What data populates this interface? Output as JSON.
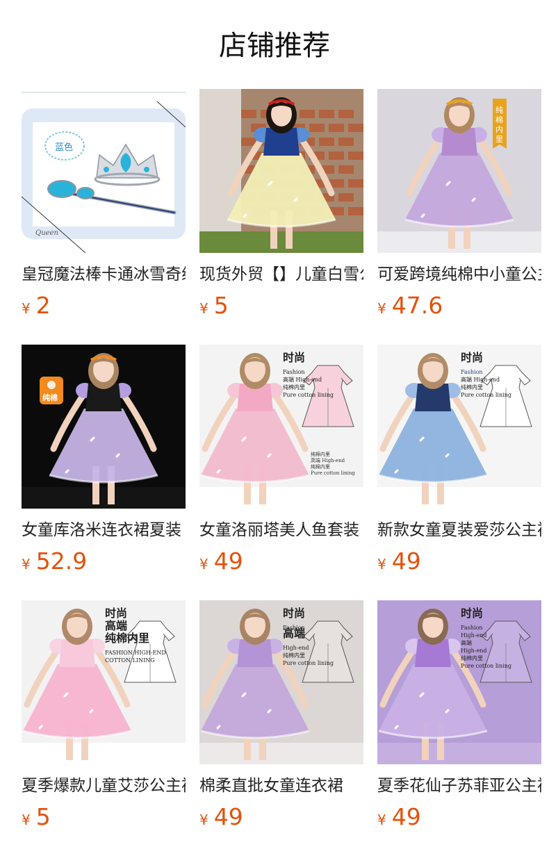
{
  "section": {
    "title": "店铺推荐"
  },
  "currency_symbol": "¥",
  "products": [
    {
      "title": "皇冠魔法棒卡通冰雪奇缘",
      "price": "2",
      "image": {
        "kind": "crown-wand",
        "bg": "#ffffff",
        "panel": "#dfe9f6",
        "badge_text": "蓝色",
        "signature": "Queen"
      }
    },
    {
      "title": "现货外贸【】儿童白雪公主",
      "price": "5",
      "image": {
        "kind": "dress",
        "bg": "#a7866e",
        "floor": "#6a8a3c",
        "skirt": "#f2efb6",
        "bodice": "#1f3f8f",
        "sleeve": "#5a8ed6",
        "hair": "#1d1510",
        "accent": "#cc1f1f"
      }
    },
    {
      "title": "可爱跨境纯棉中小童公主裙",
      "price": "47.6",
      "image": {
        "kind": "dress",
        "bg": "#d9d6de",
        "floor": "#ecebef",
        "skirt": "#c4a8dc",
        "bodice": "#b58bd0",
        "sleeve": "#c8b0e6",
        "hair": "#b08860",
        "accent": "#e8a31e",
        "tag_text": "纯棉内里"
      }
    },
    {
      "title": "女童库洛米连衣裙夏装",
      "price": "52.9",
      "image": {
        "kind": "dress",
        "bg": "#0b0b0b",
        "floor": "#141414",
        "skirt": "#c6b4e6",
        "bodice": "#1a1a1a",
        "sleeve": "#b39ee0",
        "hair": "#a88460",
        "accent": "#f28a1e",
        "badge_text": "纯棉"
      }
    },
    {
      "title": "女童洛丽塔美人鱼套装",
      "price": "49",
      "image": {
        "kind": "dress-sketch",
        "bg": "#f4f3f3",
        "floor": "#ffffff",
        "skirt": "#f2b9cd",
        "bodice": "#f3a9c3",
        "sleeve": "#f6c6d6",
        "hair": "#b08c66",
        "sketch_fill": "#f7d2dd",
        "lines": [
          "时尚",
          "Fashion",
          "高端 High-end",
          "纯棉内里",
          "Pure cotton lining"
        ],
        "lines2": [
          "纯棉内里",
          "高端 High-end",
          "纯棉内里",
          "Pure cotton lining"
        ]
      }
    },
    {
      "title": "新款女童夏装爱莎公主裙",
      "price": "49",
      "image": {
        "kind": "dress-sketch",
        "bg": "#f5f5f5",
        "floor": "#ffffff",
        "skirt": "#8cb2de",
        "bodice": "#233a6a",
        "sleeve": "#9dbde6",
        "hair": "#b28c68",
        "sketch_fill": "#ffffff",
        "lines": [
          "时尚",
          "Fashion",
          "高端 High-end",
          "纯棉内里",
          "Pure cotton lining"
        ]
      }
    },
    {
      "title": "夏季爆款儿童艾莎公主裙",
      "price": "5",
      "image": {
        "kind": "dress-sketch",
        "bg": "#f2f2f3",
        "floor": "#ffffff",
        "skirt": "#f7b3cf",
        "bodice": "#f8c8db",
        "sleeve": "#f9d3e2",
        "hair": "#b0896a",
        "sketch_fill": "#ffffff",
        "lines": [
          "时尚",
          "高端",
          "纯棉内里",
          "FASHION HIGH-END",
          "COTTON LINING"
        ]
      }
    },
    {
      "title": "棉柔直批女童连衣裙",
      "price": "49",
      "image": {
        "kind": "dress-sketch",
        "bg": "#dcd7d5",
        "floor": "#ece9e8",
        "skirt": "#c3a8dc",
        "bodice": "#b493d6",
        "sleeve": "#c8b2e3",
        "hair": "#a98464",
        "sketch_fill": "#e6e1df",
        "lines": [
          "时尚",
          "Fashion",
          "高端",
          "High-end",
          "纯棉内里",
          "Pure cotton lining"
        ]
      }
    },
    {
      "title": "夏季花仙子苏菲亚公主裙",
      "price": "49",
      "image": {
        "kind": "dress-sketch",
        "bg": "#b69ed8",
        "floor": "#c4afe0",
        "skirt": "#c9b0e5",
        "bodice": "#a67ad4",
        "sleeve": "#d8c6ef",
        "hair": "#8a6a52",
        "sketch_fill": "#c6b2e2",
        "lines": [
          "时尚",
          "Fashion",
          "High-end",
          "高端",
          "High-end",
          "纯棉内里",
          "Pure cotton lining"
        ]
      }
    }
  ]
}
